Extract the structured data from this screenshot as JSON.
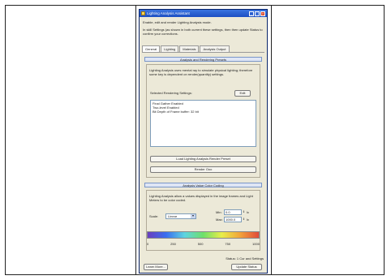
{
  "window": {
    "title": "Lighting Analysis Assistant",
    "min": "_",
    "max": "□",
    "close": "×"
  },
  "intro": {
    "line1": "Enable, edit and render Lighting Analysis mode.",
    "line2": "In skill Settings (as shown in both current these settings, then then update Status to confirm your corrections."
  },
  "tabs": [
    "General",
    "Lighting",
    "Materials",
    "Analysis Output"
  ],
  "sections": {
    "rendering": "Analysis and Rendering Presets",
    "color": "Analysis Value Color Coding"
  },
  "rendering": {
    "desc": "Lighting Analysis uses mental ray to simulate physical lighting; therefore some key is dependent on render(quantity) settings.",
    "settings_label": "Selected Rendering Settings:",
    "edit_button": "Edit",
    "items": [
      "Final Gather Enabled",
      "Two-level Enabled",
      "Bit Depth of Frame buffer: 32 bit"
    ],
    "preset_button": "Load Lighting Analysis Render Preset",
    "render_button": "Render Ooo"
  },
  "color": {
    "desc": "Lighting Analysis allow a values displayed in the image frames and Light Meters to be color coded.",
    "scale_label": "Scale:",
    "scale_value": "Linear",
    "min_label": "Min:",
    "min_value": "0.0",
    "max_label": "Max:",
    "max_value": "1000.0",
    "unit": "lx",
    "ticks": [
      "0",
      "250",
      "500",
      "750",
      "1000"
    ]
  },
  "footer": {
    "status": "Status: 1 Cur and Settings",
    "left_button": "Learn More...",
    "right_button": "Update Status"
  }
}
